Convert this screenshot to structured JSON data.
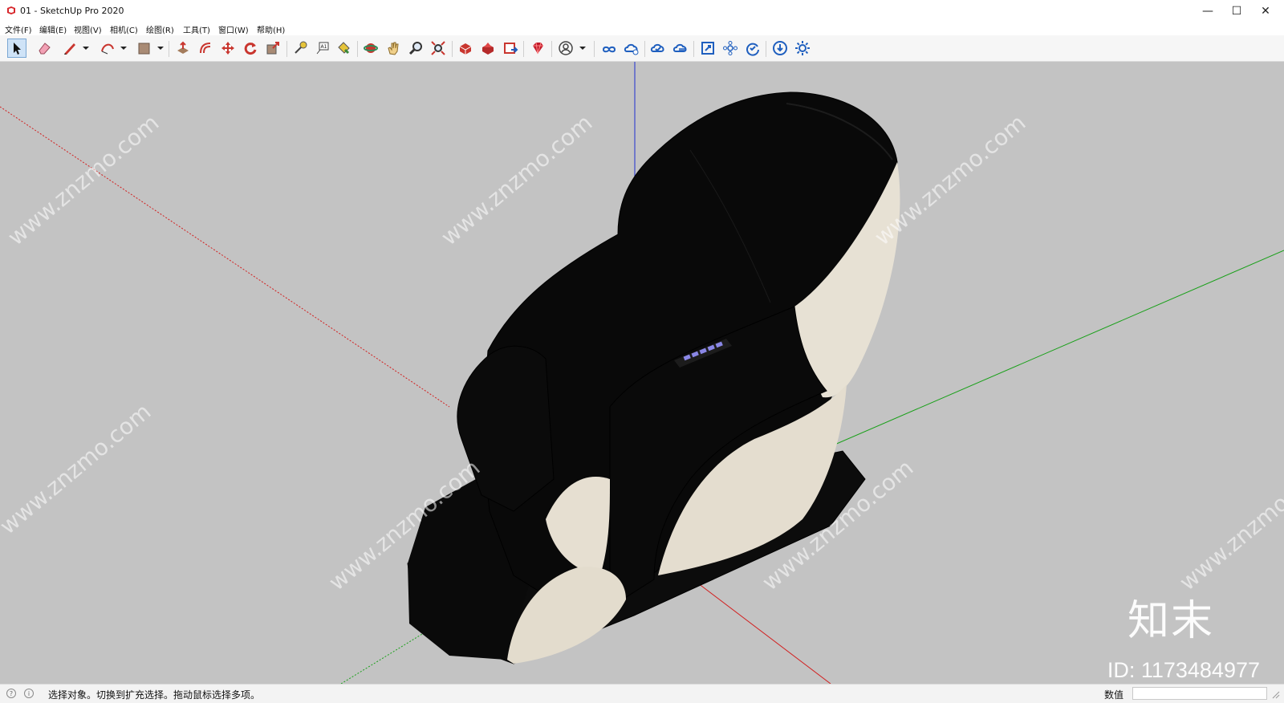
{
  "window": {
    "title": "01 - SketchUp Pro 2020",
    "controls": [
      "minimize",
      "maximize",
      "close"
    ]
  },
  "menu": {
    "items": [
      "文件(F)",
      "编辑(E)",
      "视图(V)",
      "相机(C)",
      "绘图(R)",
      "工具(T)",
      "窗口(W)",
      "帮助(H)"
    ]
  },
  "toolbar": {
    "tools": [
      {
        "icon": "select-arrow-icon",
        "active": true
      },
      {
        "icon": "eraser-icon"
      },
      {
        "icon": "pencil-line-icon",
        "has_dropdown": true
      },
      {
        "icon": "arc-icon",
        "has_dropdown": true
      },
      {
        "icon": "rectangle-shape-icon",
        "has_dropdown": true
      },
      {
        "icon": "push-pull-icon"
      },
      {
        "icon": "offset-icon"
      },
      {
        "icon": "move-icon"
      },
      {
        "icon": "rotate-icon"
      },
      {
        "icon": "scale-icon"
      },
      {
        "icon": "tape-measure-icon"
      },
      {
        "icon": "text-label-icon"
      },
      {
        "icon": "paint-bucket-icon"
      },
      {
        "icon": "orbit-icon"
      },
      {
        "icon": "pan-hand-icon"
      },
      {
        "icon": "zoom-icon"
      },
      {
        "icon": "zoom-extents-icon"
      },
      {
        "icon": "3d-warehouse-icon"
      },
      {
        "icon": "extension-warehouse-icon"
      },
      {
        "icon": "send-to-layout-icon"
      },
      {
        "icon": "ruby-icon"
      },
      {
        "icon": "account-user-icon",
        "has_dropdown": true
      },
      {
        "icon": "trimble-connect-icon"
      },
      {
        "icon": "cloud-collaborate-icon"
      },
      {
        "icon": "cloud-sync-icon"
      },
      {
        "icon": "cloud-share-icon"
      },
      {
        "icon": "frame-expand-icon"
      },
      {
        "icon": "components-icon"
      },
      {
        "icon": "refresh-check-icon"
      },
      {
        "icon": "download-icon"
      },
      {
        "icon": "settings-gear-icon"
      }
    ]
  },
  "viewport": {
    "background_color": "#c3c3c3",
    "axis_colors": {
      "x": "#d22020",
      "y": "#19a019",
      "z": "#1f2fd0"
    },
    "model": "massage-chair",
    "model_colors": {
      "body": "#0a0a0a",
      "fabric": "#e7e1d4",
      "buttons": "#8a87e6"
    },
    "watermark_text": "www.znzmo.com",
    "watermark_logo": "知末",
    "watermark_id": "ID: 1173484977"
  },
  "status": {
    "message": "选择对象。切换到扩充选择。拖动鼠标选择多项。",
    "value_label": "数值",
    "value": ""
  }
}
